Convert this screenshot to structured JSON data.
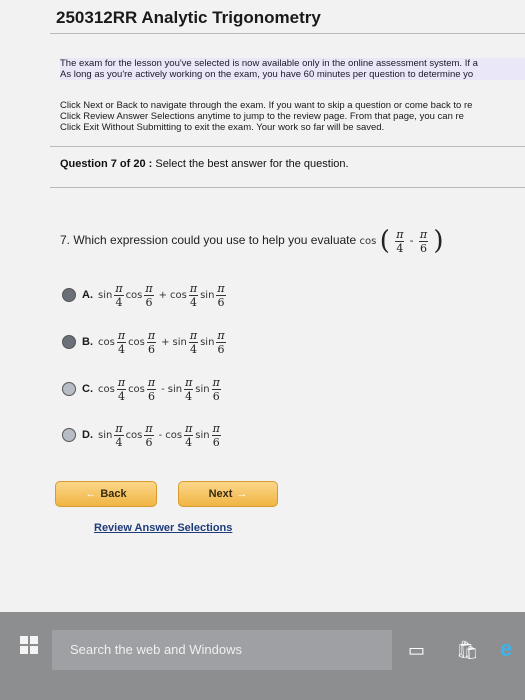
{
  "header": {
    "title": "250312RR    Analytic Trigonometry"
  },
  "notice": {
    "line1": "The exam for the lesson you've selected is now available only in the online assessment system. If a",
    "line2": "As long as you're actively working on the exam, you have 60 minutes per question to determine yo"
  },
  "nav_instructions": {
    "line1": "Click Next or Back to navigate through the exam. If you want to skip a question or come back to re",
    "line2": "Click Review Answer Selections anytime to jump to the review page. From that page, you can re",
    "line3": "Click Exit Without Submitting to exit the exam. Your work so far will be saved."
  },
  "question": {
    "header_bold": "Question 7 of 20 :",
    "header_rest": " Select the best answer for the question.",
    "text": "7.  Which expression could you use to help you evaluate",
    "expr_fn": "cos",
    "pi": "π",
    "d4": "4",
    "d6": "6",
    "minus": "-"
  },
  "options": [
    {
      "label": "A.",
      "f1": "sin",
      "f2": "cos",
      "op": "+",
      "f3": "cos",
      "f4": "sin"
    },
    {
      "label": "B.",
      "f1": "cos",
      "f2": "cos",
      "op": "+",
      "f3": "sin",
      "f4": "sin"
    },
    {
      "label": "C.",
      "f1": "cos",
      "f2": "cos",
      "op": "-",
      "f3": "sin",
      "f4": "sin"
    },
    {
      "label": "D.",
      "f1": "sin",
      "f2": "cos",
      "op": "-",
      "f3": "cos",
      "f4": "sin"
    }
  ],
  "buttons": {
    "back": "Back",
    "next": "Next",
    "review": "Review Answer Selections"
  },
  "taskbar": {
    "search_placeholder": "Search the web and Windows"
  }
}
